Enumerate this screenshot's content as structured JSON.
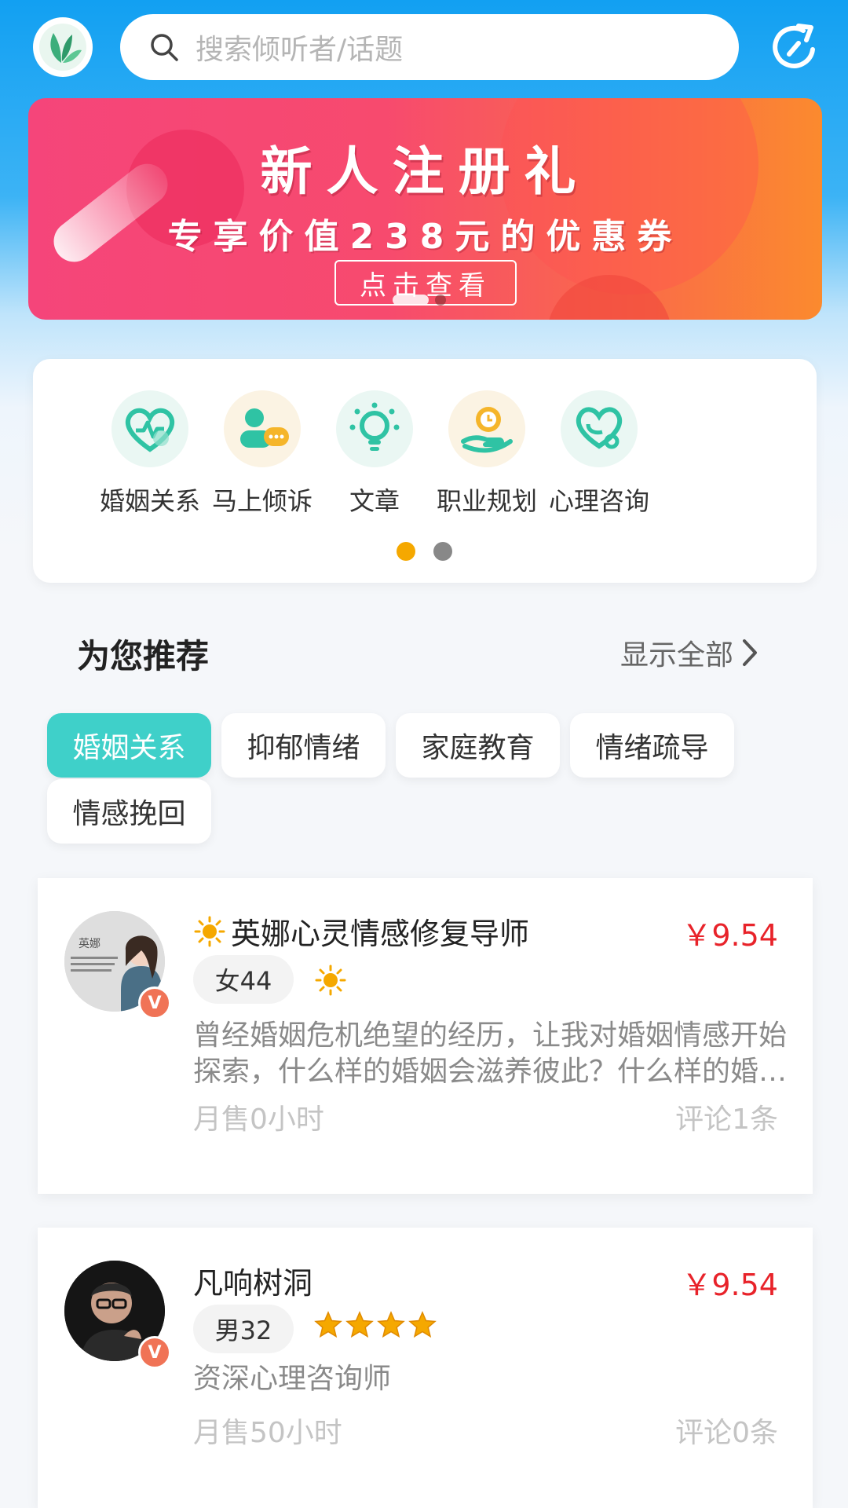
{
  "header": {
    "search_placeholder": "搜索倾听者/话题",
    "logo_icon": "butterfly-logo-icon",
    "search_icon": "search-icon",
    "refresh_icon": "refresh-icon"
  },
  "banner": {
    "title": "新人注册礼",
    "subtitle": "专享价值238元的优惠券",
    "cta": "点击查看"
  },
  "categories": {
    "items": [
      {
        "label": "婚姻关系",
        "icon": "heart-pulse-icon"
      },
      {
        "label": "马上倾诉",
        "icon": "chat-person-icon"
      },
      {
        "label": "文章",
        "icon": "lightbulb-icon"
      },
      {
        "label": "职业规划",
        "icon": "clock-hand-icon"
      },
      {
        "label": "心理咨询",
        "icon": "stethoscope-heart-icon"
      }
    ],
    "page": 1,
    "pages": 2
  },
  "recommend": {
    "title": "为您推荐",
    "show_all": "显示全部"
  },
  "tags": [
    "婚姻关系",
    "抑郁情绪",
    "家庭教育",
    "情绪疏导",
    "情感挽回"
  ],
  "selected_tag": "婚姻关系",
  "listeners": [
    {
      "name": "英娜心灵情感修复导师",
      "name_prefix_icon": "sun-icon",
      "price": "￥9.54",
      "gender_age": "女44",
      "level_icon": "sun-icon",
      "description": "曾经婚姻危机绝望的经历，让我对婚姻情感开始探索，什么样的婚姻会滋养彼此？什么样的婚姻会让彼此痛苦？",
      "monthly_sales": "月售0小时",
      "reviews": "评论1条",
      "avatar_caption": "英娜",
      "verified": "V"
    },
    {
      "name": "凡响树洞",
      "price": "￥9.54",
      "gender_age": "男32",
      "rating": 4,
      "description": "资深心理咨询师",
      "monthly_sales": "月售50小时",
      "reviews": "评论0条",
      "verified": "V"
    }
  ],
  "colors": {
    "header_blue": "#12a0f2",
    "accent_teal": "#3fd0c9",
    "price_red": "#e8232a",
    "dot_active": "#f5a800",
    "badge_orange": "#f07356"
  }
}
